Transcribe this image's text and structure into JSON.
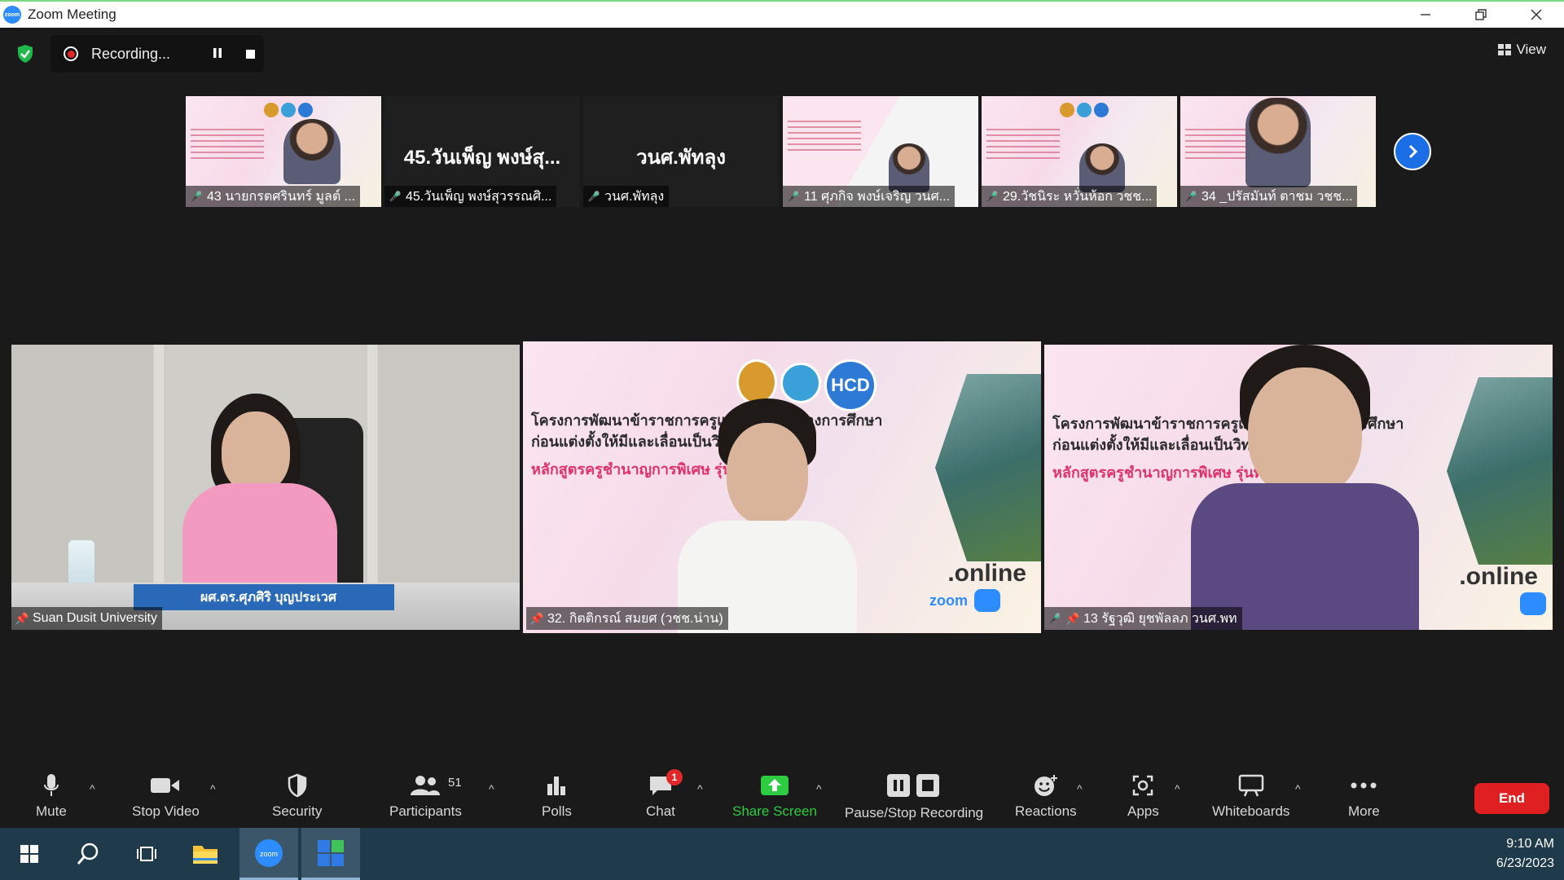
{
  "window": {
    "title": "Zoom Meeting",
    "app_icon_text": "zoom"
  },
  "recording": {
    "label": "Recording..."
  },
  "view_button": {
    "label": "View"
  },
  "thumbnails": [
    {
      "name": "43 นายกรตศรินทร์ มูลต์ ...",
      "type": "video"
    },
    {
      "name": "45.วันเพ็ญ พงษ์สุวรรณศิ...",
      "display_name": "45.วันเพ็ญ พงษ์สุ...",
      "type": "name"
    },
    {
      "name": "วนศ.พัทลุง",
      "display_name": "วนศ.พัทลุง",
      "type": "name"
    },
    {
      "name": "11 ศุภกิจ พงษ์เจริญ วนศ...",
      "type": "video"
    },
    {
      "name": "29.วัชนิระ หวั่นห้อก วชช...",
      "type": "video"
    },
    {
      "name": "34 _ปรัสมันท์ ตาชม วชช...",
      "type": "video"
    }
  ],
  "tiles": [
    {
      "name": "Suan Dusit University",
      "banner": "ผศ.ดร.ศุภศิริ บุญประเวศ"
    },
    {
      "name": "32. กิตติกรณ์ สมยศ (วชช.น่าน)"
    },
    {
      "name": "13 รัฐวุฒิ ยุชพัลลภ วนศ.พท"
    }
  ],
  "slide": {
    "line1": "โครงการพัฒนาข้าราชการครูและบุคลากรทางการศึกษา",
    "line2": "ก่อนแต่งตั้งให้มีและเลื่อนเป็นวิทยฐานะ",
    "line3": "หลักสูตรครูชำนาญการพิเศษ รุ่นที่ 130",
    "logo_text": "HCD",
    "online_text": ".online",
    "zoom_text": "zoom"
  },
  "toolbar": {
    "mute": "Mute",
    "stop_video": "Stop Video",
    "security": "Security",
    "participants": "Participants",
    "participants_count": "51",
    "polls": "Polls",
    "chat": "Chat",
    "chat_badge": "1",
    "share_screen": "Share Screen",
    "pause_stop_recording": "Pause/Stop Recording",
    "reactions": "Reactions",
    "apps": "Apps",
    "whiteboards": "Whiteboards",
    "more": "More",
    "end": "End"
  },
  "taskbar": {
    "time": "9:10 AM",
    "date": "6/23/2023"
  },
  "colors": {
    "accent": "#2d8cff",
    "end": "#e02020",
    "share": "#2ecc40",
    "active_speaker": "#e6f24a"
  }
}
